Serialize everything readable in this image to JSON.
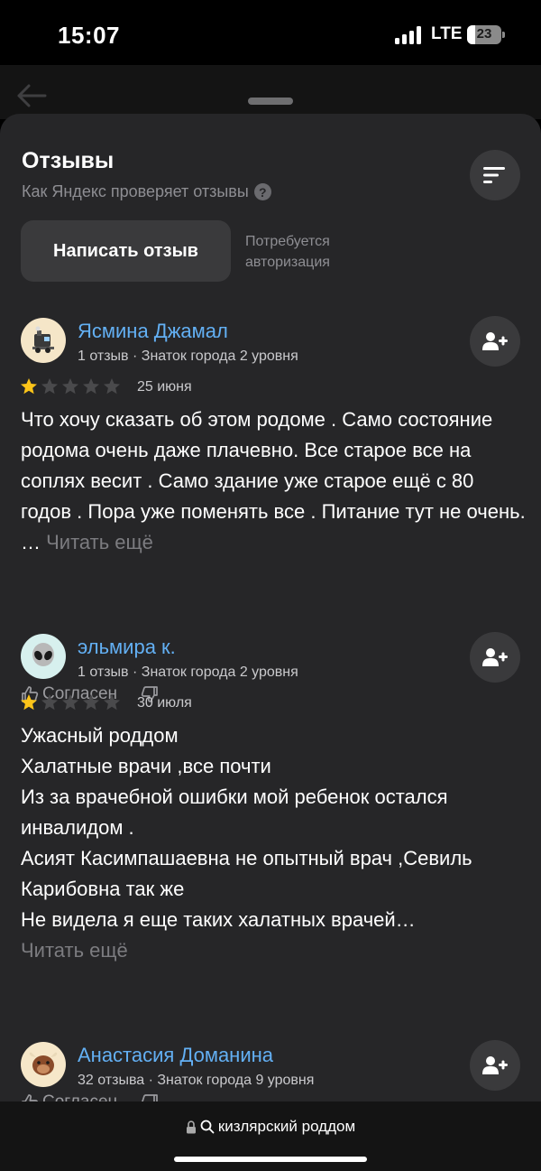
{
  "status_bar": {
    "time": "15:07",
    "network": "LTE",
    "battery": "23"
  },
  "sheet": {
    "title": "Отзывы",
    "subtitle": "Как Яндекс проверяет отзывы",
    "help_glyph": "?",
    "write_review_label": "Написать отзыв",
    "auth_note": "Потребуется авторизация"
  },
  "reviews": [
    {
      "author": "Ясмина Джамал",
      "meta": "1 отзыв · Знаток города 2 уровня",
      "rating": 1,
      "date": "25 июня",
      "text": "Что хочу сказать об этом родоме . Само состояние родома очень даже плачевно. Все старое все на соплях весит . Само здание уже старое ещё с 80 годов . Пора уже поменять все . Питание тут не очень. …",
      "read_more": "Читать ещё",
      "agree_label": "Согласен",
      "avatar_icon": "train-icon"
    },
    {
      "author": "эльмира к.",
      "meta": "1 отзыв · Знаток города 2 уровня",
      "rating": 1,
      "date": "30 июля",
      "text": "Ужасный роддом\nХалатные врачи ,все почти\nИз за врачебной ошибки мой ребенок остался инвалидом .\nАсият Касимпашаевна не опытный врач ,Севиль Карибовна так же\nНе видела я еще таких халатных врачей…",
      "read_more": "Читать ещё",
      "agree_label": "Согласен",
      "avatar_icon": "alien-icon"
    },
    {
      "author": "Анастасия Доманина",
      "meta": "32 отзыва · Знаток города 9 уровня",
      "avatar_icon": "yak-icon"
    }
  ],
  "bottom_bar": {
    "address": "кизлярский роддом"
  },
  "colors": {
    "author_link": "#63b0f4",
    "star_filled": "#fcc419",
    "star_empty": "#4a4a4c",
    "sheet_bg": "#262628",
    "button_bg": "#3a3a3c"
  }
}
